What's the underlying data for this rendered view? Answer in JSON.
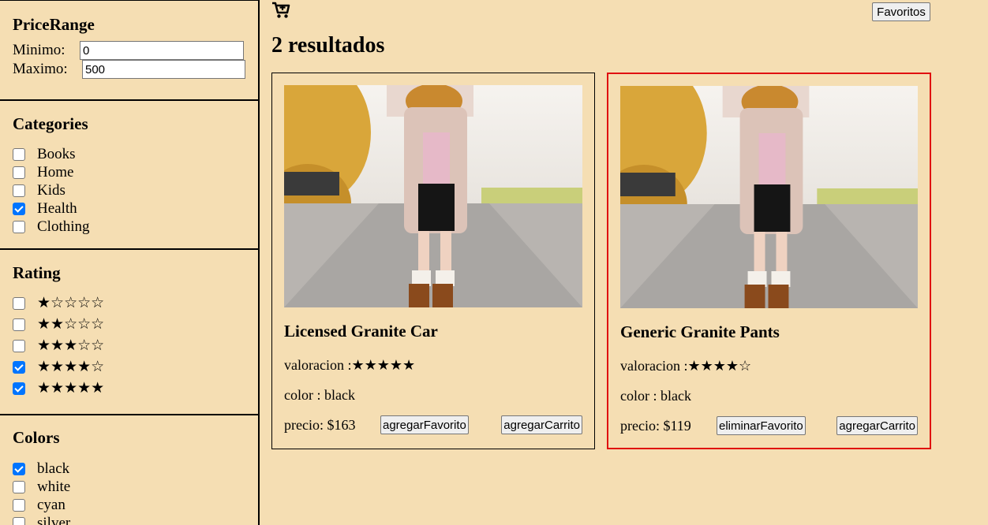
{
  "sidebar": {
    "price": {
      "title": "PriceRange",
      "min_label": "Minimo:",
      "min_value": "0",
      "max_label": "Maximo:",
      "max_value": "500"
    },
    "categories": {
      "title": "Categories",
      "items": [
        {
          "label": "Books",
          "checked": false
        },
        {
          "label": "Home",
          "checked": false
        },
        {
          "label": "Kids",
          "checked": false
        },
        {
          "label": "Health",
          "checked": true
        },
        {
          "label": "Clothing",
          "checked": false
        }
      ]
    },
    "rating": {
      "title": "Rating",
      "items": [
        {
          "label": "★☆☆☆☆",
          "checked": false
        },
        {
          "label": "★★☆☆☆",
          "checked": false
        },
        {
          "label": "★★★☆☆",
          "checked": false
        },
        {
          "label": "★★★★☆",
          "checked": true
        },
        {
          "label": "★★★★★",
          "checked": true
        }
      ]
    },
    "colors": {
      "title": "Colors",
      "items": [
        {
          "label": "black",
          "checked": true
        },
        {
          "label": "white",
          "checked": false
        },
        {
          "label": "cyan",
          "checked": false
        },
        {
          "label": "silver",
          "checked": false
        }
      ]
    }
  },
  "header": {
    "cart_icon": "cart-plus-icon",
    "favorites_label": "Favoritos"
  },
  "results_title": "2 resultados",
  "products": [
    {
      "name": "Licensed Granite Car",
      "rating_text": "valoracion :★★★★★",
      "color_text": "color : black",
      "price_text": "precio: $163",
      "fav_button": "agregarFavorito",
      "cart_button": "agregarCarrito"
    },
    {
      "name": "Generic Granite Pants",
      "rating_text": "valoracion :★★★★☆",
      "color_text": "color : black",
      "price_text": "precio: $119",
      "fav_button": "eliminarFavorito",
      "cart_button": "agregarCarrito"
    }
  ],
  "colors": {
    "background": "#f5deb3",
    "selected_card_border": "#e01010",
    "checkbox_accent": "#0075ff"
  }
}
